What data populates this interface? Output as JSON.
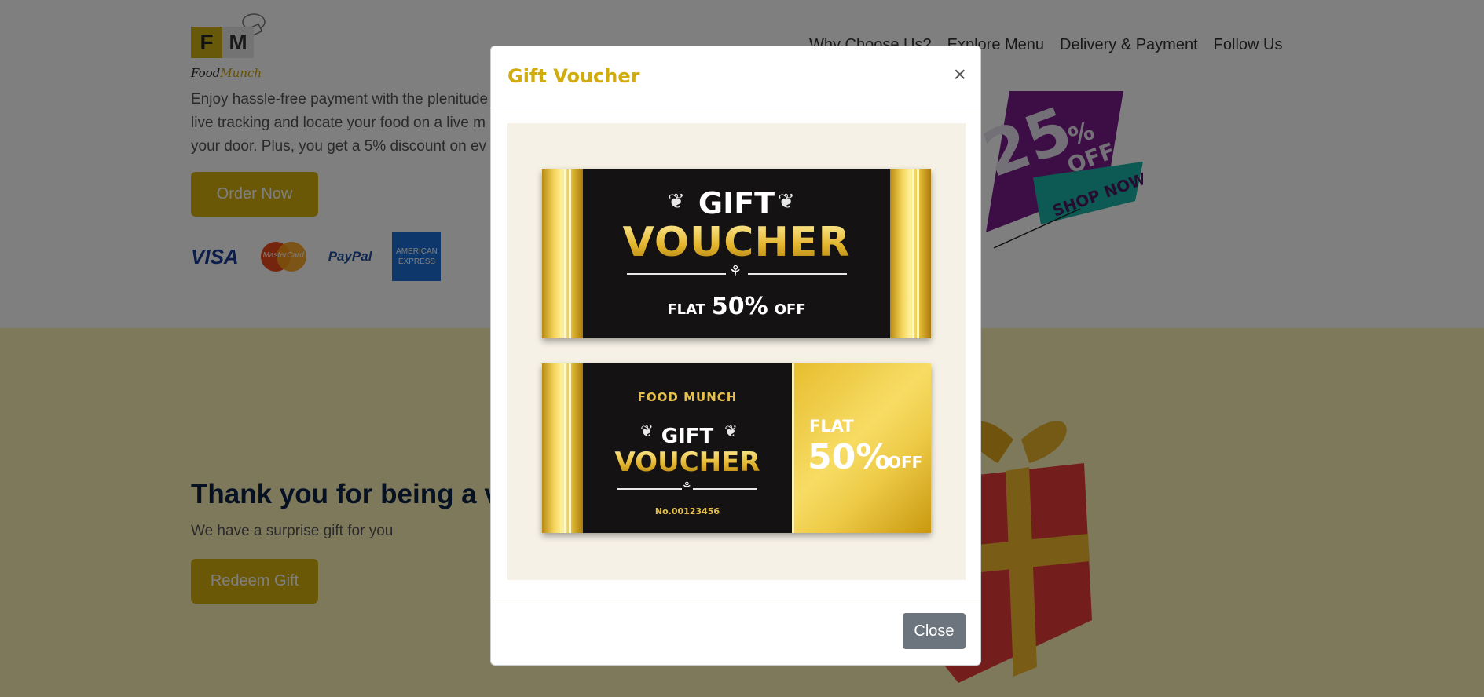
{
  "brand": {
    "logo_letters": [
      "F",
      "M"
    ],
    "logo_word_1": "Food",
    "logo_word_2": "Munch"
  },
  "nav": {
    "items": [
      "Why Choose Us?",
      "Explore Menu",
      "Delivery & Payment",
      "Follow Us"
    ]
  },
  "delivery": {
    "text_lines": [
      "Enjoy hassle-free payment with the plenitude",
      "live tracking and locate your food on a live m",
      "your door. Plus, you get a 5% discount on ev"
    ],
    "order_button": "Order Now",
    "payment_methods": {
      "visa": "VISA",
      "mastercard": "MasterCard",
      "paypal": "PayPal",
      "amex_line1": "AMERICAN",
      "amex_line2": "EXPRESS"
    }
  },
  "promo_badge": {
    "percent": "25",
    "percent_sign": "%",
    "off": "OFF",
    "cta": "SHOP NOW"
  },
  "gift_section": {
    "title": "Thank you for being a va",
    "subtitle": "We have a surprise gift for you",
    "redeem_button": "Redeem Gift"
  },
  "modal": {
    "title": "Gift Voucher",
    "close_x": "×",
    "close_button": "Close",
    "voucher_1": {
      "gift": "GIFT",
      "voucher": "VOUCHER",
      "flat": "FLAT",
      "percent": "50%",
      "off": "OFF"
    },
    "voucher_2": {
      "brand": "FOOD MUNCH",
      "gift": "GIFT",
      "voucher": "VOUCHER",
      "number": "No.00123456",
      "flat": "FLAT",
      "percent": "50%",
      "off": "OFF"
    }
  },
  "colors": {
    "accent": "#d0ac0f",
    "button_yellow": "#d4b10d",
    "heading_navy": "#0c2448",
    "close_gray": "#6c757d",
    "gift_section_bg": "#fff3b8"
  },
  "icons": {
    "close": "close-icon",
    "chef_hat": "chef-hat-icon",
    "bow": "ribbon-bow-icon",
    "holly": "holly-leaf-icon"
  }
}
